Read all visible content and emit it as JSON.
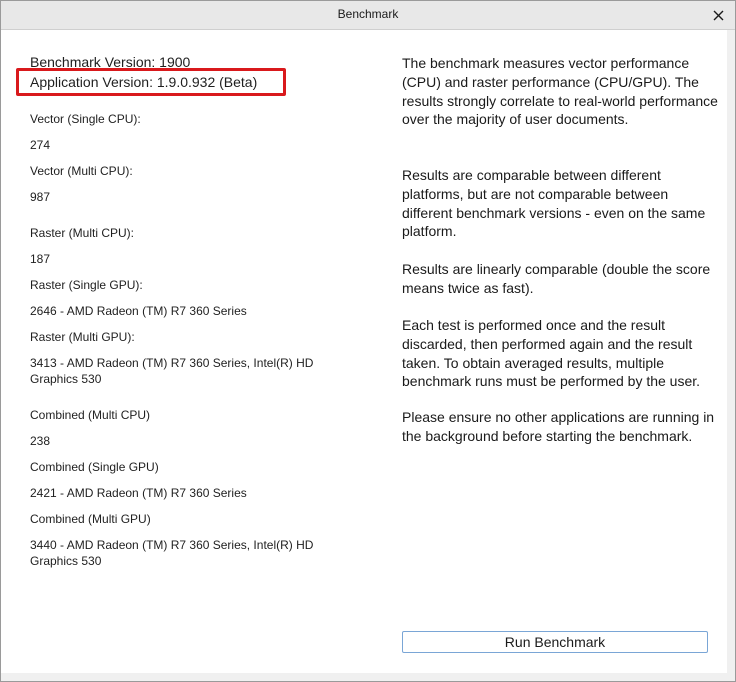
{
  "window": {
    "title": "Benchmark"
  },
  "info": {
    "benchmark_version": "Benchmark Version: 1900",
    "application_version": "Application Version: 1.9.0.932 (Beta)"
  },
  "results": [
    {
      "label": "Vector (Single CPU):",
      "value": "274"
    },
    {
      "label": "Vector (Multi CPU):",
      "value": "987"
    },
    {
      "label": "Raster (Multi CPU):",
      "value": "187"
    },
    {
      "label": "Raster (Single GPU):",
      "value": "2646 - AMD Radeon (TM) R7 360 Series"
    },
    {
      "label": "Raster (Multi GPU):",
      "value": "3413 - AMD Radeon (TM) R7 360 Series, Intel(R) HD Graphics 530"
    },
    {
      "label": "Combined (Multi CPU)",
      "value": "238"
    },
    {
      "label": "Combined (Single GPU)",
      "value": "2421 - AMD Radeon (TM) R7 360 Series"
    },
    {
      "label": "Combined (Multi GPU)",
      "value": "3440 - AMD Radeon (TM) R7 360 Series, Intel(R) HD Graphics 530"
    }
  ],
  "description": [
    "The benchmark measures vector performance (CPU) and raster performance (CPU/GPU). The results strongly correlate to real-world performance over the majority of user documents.",
    "Results are comparable between different platforms, but are not comparable between different benchmark versions - even on the same platform.",
    "Results are linearly comparable (double the score means twice as fast).",
    "Each test is performed once and the result discarded, then performed again and the result taken. To obtain averaged results, multiple benchmark runs must be performed by the user.",
    "Please ensure no other applications are running in the background before starting the benchmark."
  ],
  "actions": {
    "run_label": "Run Benchmark"
  },
  "icons": {
    "close": "close-icon"
  },
  "colors": {
    "highlight": "#d9191c",
    "button_border": "#7aa6d6"
  }
}
